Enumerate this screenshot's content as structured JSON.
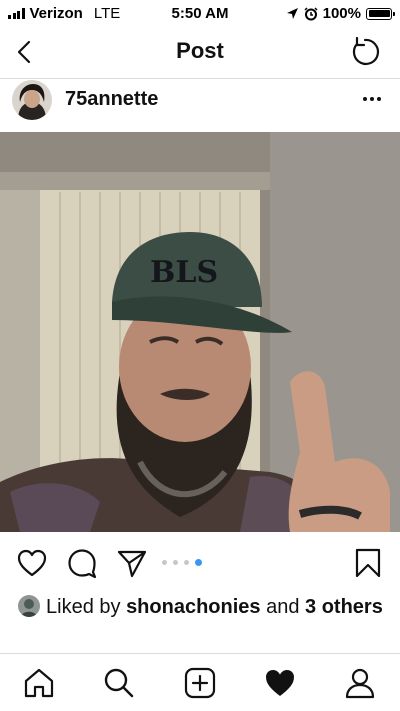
{
  "status_bar": {
    "carrier": "Verizon",
    "network": "LTE",
    "time": "5:50 AM",
    "battery": "100%",
    "icons": [
      "signal-icon",
      "location-arrow-icon",
      "alarm-icon",
      "battery-icon"
    ]
  },
  "nav": {
    "title": "Post",
    "back_icon": "chevron-left-icon",
    "refresh_icon": "refresh-icon"
  },
  "post": {
    "username": "75annette",
    "more_icon": "ellipsis-icon",
    "carousel": {
      "total": 4,
      "active_index": 3
    },
    "likes": {
      "prefix": "Liked by ",
      "liker": "shonachonies",
      "middle": " and ",
      "others": "3 others"
    }
  },
  "actions": {
    "icons": [
      "heart-outline-icon",
      "comment-icon",
      "share-icon",
      "bookmark-icon"
    ]
  },
  "tabs": [
    "home-icon",
    "search-icon",
    "add-post-icon",
    "activity-heart-icon",
    "profile-icon"
  ],
  "colors": {
    "accent": "#3897f0",
    "divider": "#dbdbdb",
    "text": "#111111"
  }
}
